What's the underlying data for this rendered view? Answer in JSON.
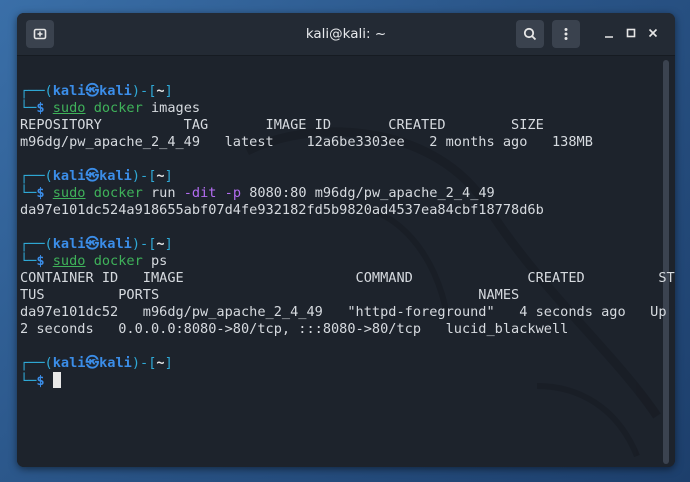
{
  "window": {
    "title": "kali@kali: ~",
    "new_tab_icon": "new-tab-icon",
    "search_icon": "search-icon",
    "menu_icon": "kebab-menu-icon",
    "minimize_icon": "minimize-icon",
    "maximize_icon": "maximize-icon",
    "close_icon": "close-icon"
  },
  "colors": {
    "terminal_bg": "#1d232c",
    "prompt_frame": "#2fa9d6",
    "prompt_user": "#3b8de8",
    "command": "#3fb25a",
    "flag": "#b26cf0",
    "output": "#d6dadf"
  },
  "prompt": {
    "open": "┌──(",
    "user": "kali㉿kali",
    "mid": ")-[",
    "cwd": "~",
    "close": "]",
    "corner": "└─",
    "dollar": "$"
  },
  "blocks": [
    {
      "command": {
        "sudo": "sudo",
        "docker": "docker",
        "args": "images"
      },
      "output": [
        "REPOSITORY          TAG       IMAGE ID       CREATED        SIZE",
        "m96dg/pw_apache_2_4_49   latest    12a6be3303ee   2 months ago   138MB"
      ]
    },
    {
      "command": {
        "sudo": "sudo",
        "docker": "docker",
        "run": "run",
        "flags": "-dit -p",
        "args": "8080:80 m96dg/pw_apache_2_4_49"
      },
      "output": [
        "da97e101dc524a918655abf07d4fe932182fd5b9820ad4537ea84cbf18778d6b"
      ]
    },
    {
      "command": {
        "sudo": "sudo",
        "docker": "docker",
        "args": "ps"
      },
      "output": [
        "CONTAINER ID   IMAGE                     COMMAND              CREATED         STA",
        "TUS         PORTS                                       NAMES",
        "da97e101dc52   m96dg/pw_apache_2_4_49   \"httpd-foreground\"   4 seconds ago   Up",
        "2 seconds   0.0.0.0:8080->80/tcp, :::8080->80/tcp   lucid_blackwell"
      ]
    }
  ]
}
